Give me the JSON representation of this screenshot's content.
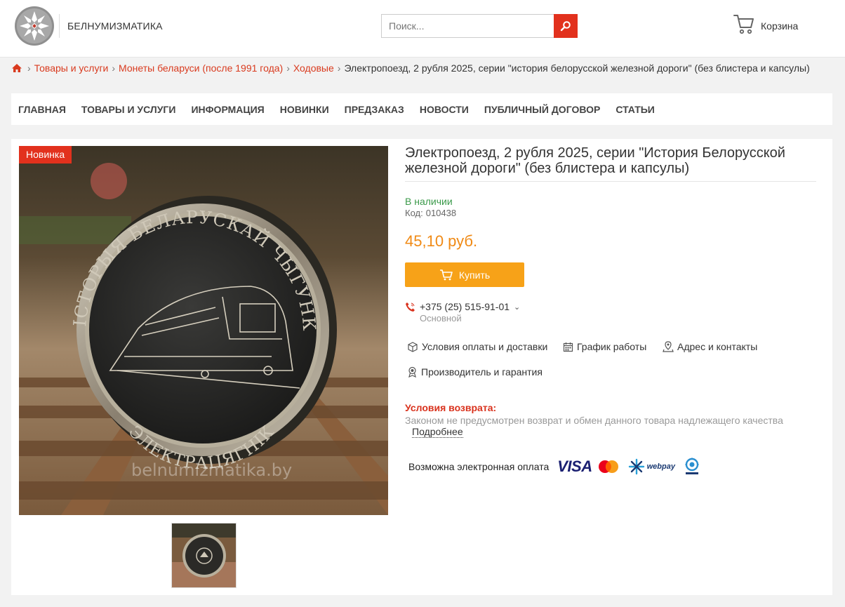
{
  "header": {
    "site_name": "БЕЛНУМИЗМАТИКА",
    "search_placeholder": "Поиск...",
    "cart_label": "Корзина"
  },
  "breadcrumb": {
    "items": [
      "Товары и услуги",
      "Монеты беларуси (после 1991 года)",
      "Ходовые"
    ],
    "current": "Электропоезд, 2 рубля 2025, серии \"история белорусской железной дороги\" (без блистера и капсулы)"
  },
  "nav": {
    "items": [
      "ГЛАВНАЯ",
      "ТОВАРЫ И УСЛУГИ",
      "ИНФОРМАЦИЯ",
      "НОВИНКИ",
      "ПРЕДЗАКАЗ",
      "НОВОСТИ",
      "ПУБЛИЧНЫЙ ДОГОВОР",
      "СТАТЬИ"
    ]
  },
  "product": {
    "badge": "Новинка",
    "title": "Электропоезд, 2 рубля 2025, серии \"История Белорусской железной дороги\" (без блистера и капсулы)",
    "stock": "В наличии",
    "code_label": "Код:",
    "code": "010438",
    "price": "45,10 руб.",
    "buy_label": "Купить",
    "phone": "+375 (25) 515-91-01",
    "phone_note": "Основной",
    "coin_top_text": "ГІСТОРЫЯ БЕЛАРУСКАЙ ЧЫГУНКІ",
    "coin_bottom_text": "ЭЛЕКТРАЦЯГНІК",
    "watermark": "belnumizmatika.by"
  },
  "info_links": [
    "Условия оплаты и доставки",
    "График работы",
    "Адрес и контакты",
    "Производитель и гарантия"
  ],
  "returns": {
    "title": "Условия возврата:",
    "text": "Законом не предусмотрен возврат и обмен данного товара надлежащего качества",
    "more": "Подробнее"
  },
  "payment": {
    "label": "Возможна электронная оплата",
    "visa": "VISA",
    "webpay": "webpay"
  },
  "colors": {
    "accent_red": "#e2311d",
    "buy_orange": "#f7a218",
    "price_orange": "#f08a15",
    "stock_green": "#3b9a4a"
  }
}
